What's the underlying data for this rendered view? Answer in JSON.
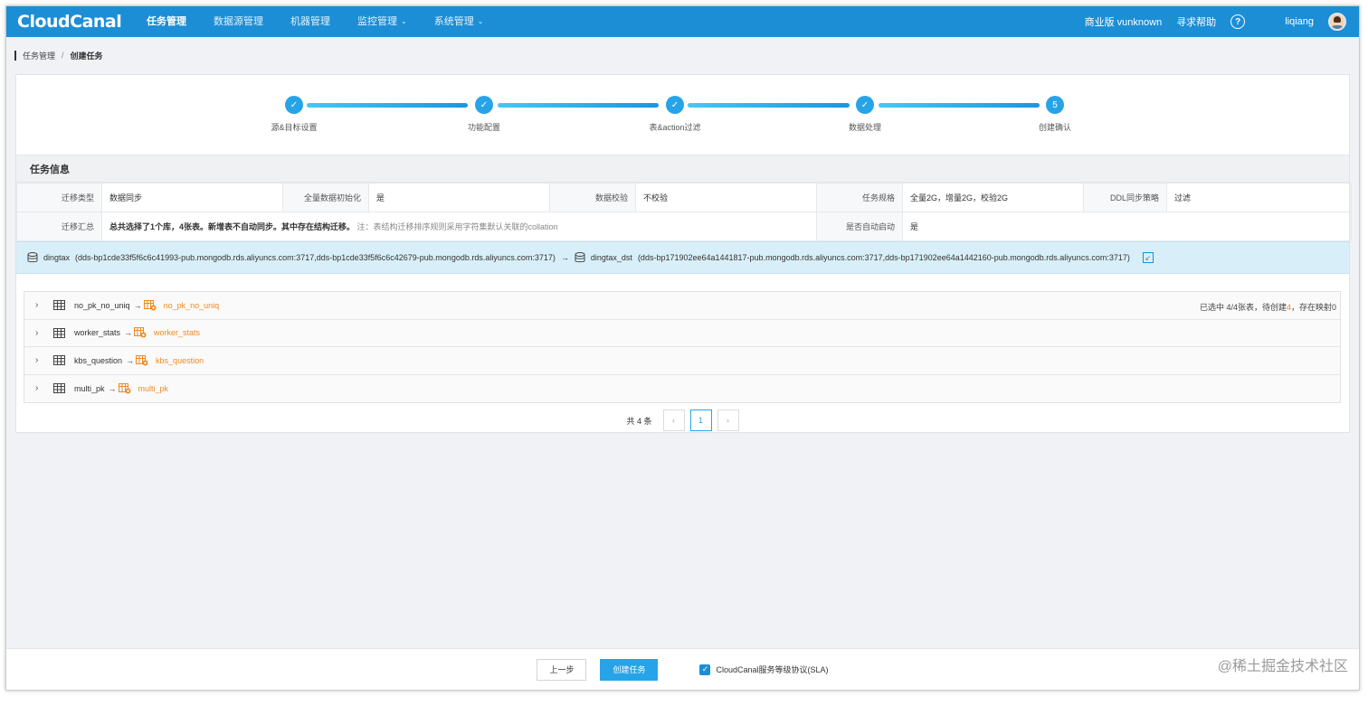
{
  "app": {
    "logo": "CloudCanal"
  },
  "nav": {
    "items": [
      {
        "label": "任务管理",
        "active": true
      },
      {
        "label": "数据源管理"
      },
      {
        "label": "机器管理"
      },
      {
        "label": "监控管理",
        "dropdown": true
      },
      {
        "label": "系统管理",
        "dropdown": true
      }
    ],
    "edition": "商业版 vunknown",
    "help": "寻求帮助",
    "help_icon": "?",
    "user": "liqiang"
  },
  "breadcrumb": {
    "parent": "任务管理",
    "separator": "/",
    "current": "创建任务"
  },
  "steps": [
    {
      "label": "源&目标设置",
      "done": true,
      "mark": "✓"
    },
    {
      "label": "功能配置",
      "done": true,
      "mark": "✓"
    },
    {
      "label": "表&action过滤",
      "done": true,
      "mark": "✓"
    },
    {
      "label": "数据处理",
      "done": true,
      "mark": "✓"
    },
    {
      "label": "创建确认",
      "done": false,
      "mark": "5"
    }
  ],
  "task_info": {
    "title": "任务信息",
    "migration_type_label": "迁移类型",
    "migration_type": "数据同步",
    "full_init_label": "全量数据初始化",
    "full_init": "是",
    "verify_label": "数据校验",
    "verify": "不校验",
    "spec_label": "任务规格",
    "spec": "全量2G，增量2G，校验2G",
    "ddl_label": "DDL同步策略",
    "ddl": "过滤",
    "summary_label": "迁移汇总",
    "summary": "总共选择了1个库，4张表。新增表不自动同步。其中存在结构迁移。",
    "summary_note": "注：表结构迁移排序规则采用字符集默认关联的collation",
    "autostart_label": "是否自动启动",
    "autostart": "是"
  },
  "db_mapping": {
    "source_db": "dingtax",
    "source_host": "(dds-bp1cde33f5f6c6c41993-pub.mongodb.rds.aliyuncs.com:3717,dds-bp1cde33f5f6c6c42679-pub.mongodb.rds.aliyuncs.com:3717)",
    "arrow": "→",
    "target_db": "dingtax_dst",
    "target_host": "(dds-bp171902ee64a1441817-pub.mongodb.rds.aliyuncs.com:3717,dds-bp171902ee64a1442160-pub.mongodb.rds.aliyuncs.com:3717)"
  },
  "tables": [
    {
      "source": "no_pk_no_uniq",
      "target": "no_pk_no_uniq"
    },
    {
      "source": "worker_stats",
      "target": "worker_stats"
    },
    {
      "source": "kbs_question",
      "target": "kbs_question"
    },
    {
      "source": "multi_pk",
      "target": "multi_pk"
    }
  ],
  "selection": {
    "prefix": "已选中 4/4张表，待创建",
    "to_create": "4",
    "suffix": "，存在映射0"
  },
  "pagination": {
    "total": "共 4 条",
    "prev": "‹",
    "page": "1",
    "next": "›"
  },
  "footer": {
    "prev_button": "上一步",
    "create_button": "创建任务",
    "sla_label": "CloudCanal服务等级协议(SLA)",
    "sla_checked": true
  },
  "watermark": "@稀土掘金技术社区",
  "colors": {
    "header": "#1c8ed6",
    "accent": "#27a4e8",
    "target": "#f08a24",
    "db_bar": "#d8eff9"
  }
}
